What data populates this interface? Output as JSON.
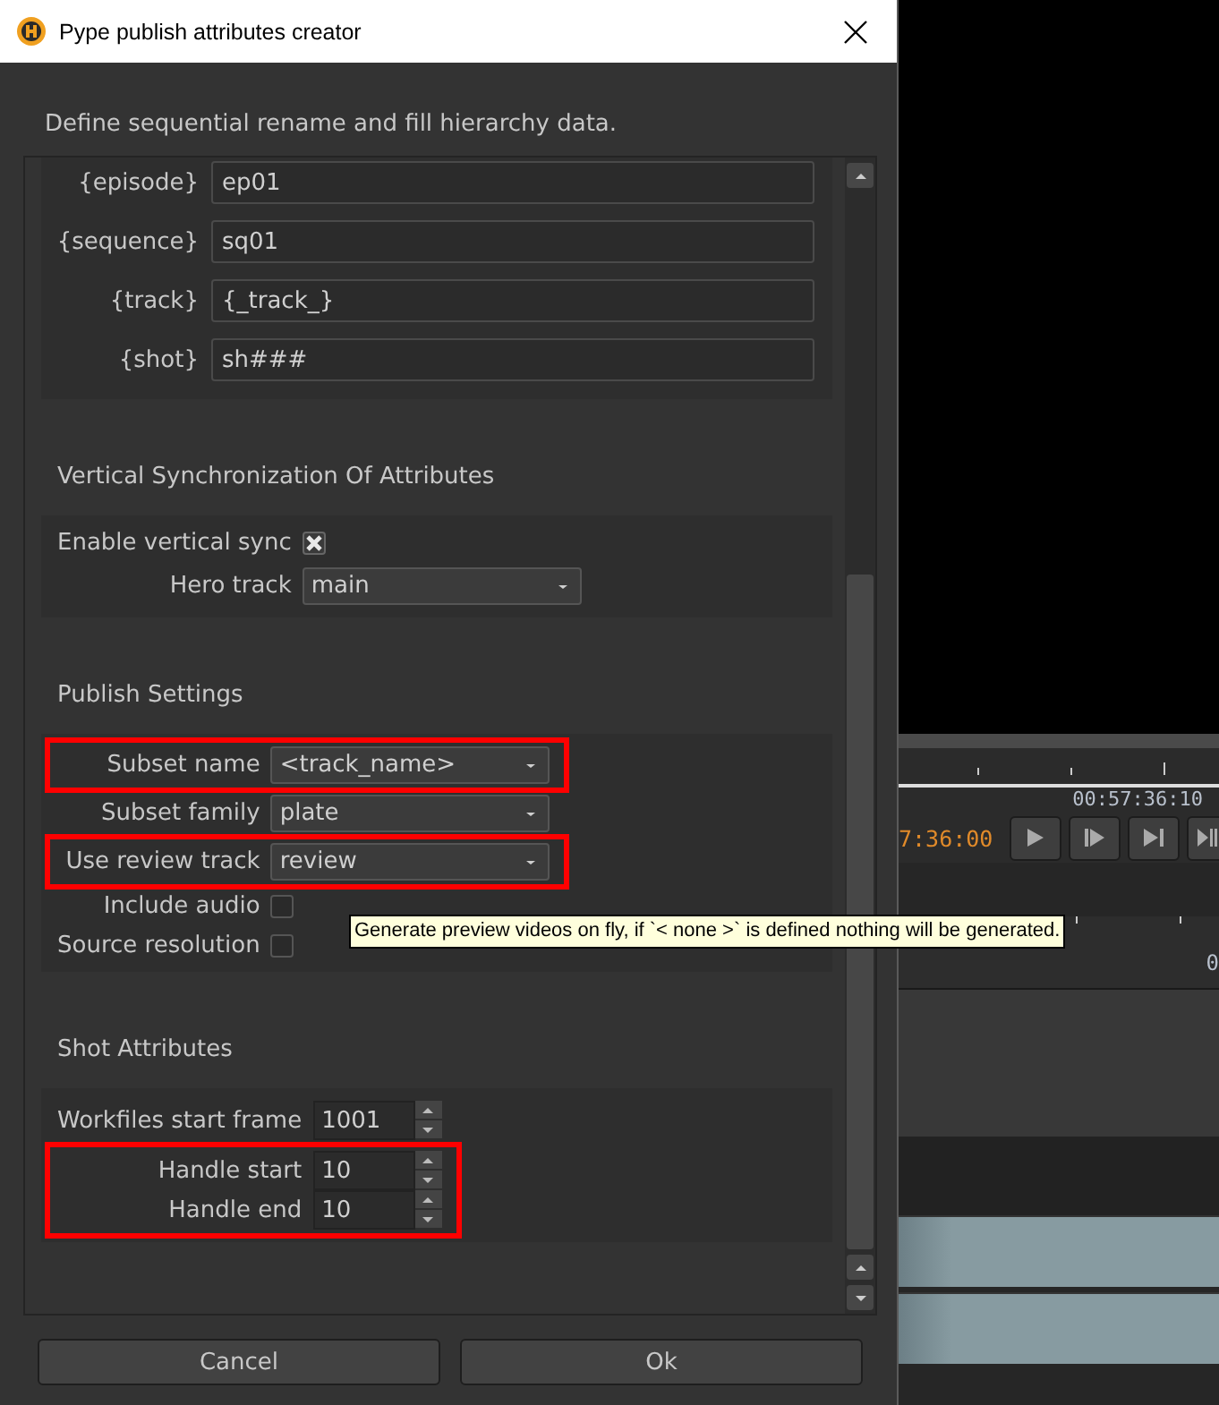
{
  "window": {
    "title": "Pype publish attributes creator"
  },
  "description": "Define sequential rename and fill hierarchy data.",
  "hierarchy": [
    {
      "label": "{episode}",
      "value": "ep01"
    },
    {
      "label": "{sequence}",
      "value": "sq01"
    },
    {
      "label": "{track}",
      "value": "{_track_}"
    },
    {
      "label": "{shot}",
      "value": "sh###"
    }
  ],
  "sections": [
    {
      "title": "Vertical Synchronization Of Attributes",
      "rows": [
        {
          "kind": "checkbox",
          "label": "Enable vertical sync",
          "checked": true,
          "highlighted": false
        },
        {
          "kind": "dropdown",
          "label": "Hero track",
          "value": "main",
          "highlighted": false
        }
      ]
    },
    {
      "title": "Publish Settings",
      "rows": [
        {
          "kind": "dropdown",
          "label": "Subset name",
          "value": "<track_name>",
          "highlighted": true
        },
        {
          "kind": "dropdown",
          "label": "Subset family",
          "value": "plate",
          "highlighted": false
        },
        {
          "kind": "dropdown",
          "label": "Use review track",
          "value": "review",
          "highlighted": true
        },
        {
          "kind": "checkbox",
          "label": "Include audio",
          "checked": false,
          "highlighted": false
        },
        {
          "kind": "checkbox",
          "label": "Source resolution",
          "checked": false,
          "highlighted": false
        }
      ]
    },
    {
      "title": "Shot Attributes",
      "rows": [
        {
          "kind": "spinbox",
          "label": "Workfiles start frame",
          "value": "1001",
          "highlighted": false
        },
        {
          "kind": "spinbox",
          "label": "Handle start",
          "value": "10",
          "highlighted": true
        },
        {
          "kind": "spinbox",
          "label": "Handle end",
          "value": "10",
          "highlighted": true
        }
      ]
    }
  ],
  "tooltip": "Generate preview videos on fly, if `< none >` is defined nothing will be generated.",
  "buttons": [
    {
      "label": "Cancel"
    },
    {
      "label": "Ok"
    }
  ],
  "background_app": {
    "timecode_top": "00:57:36:10",
    "timecode_current": "7:36:00",
    "ruler_label": "0"
  }
}
